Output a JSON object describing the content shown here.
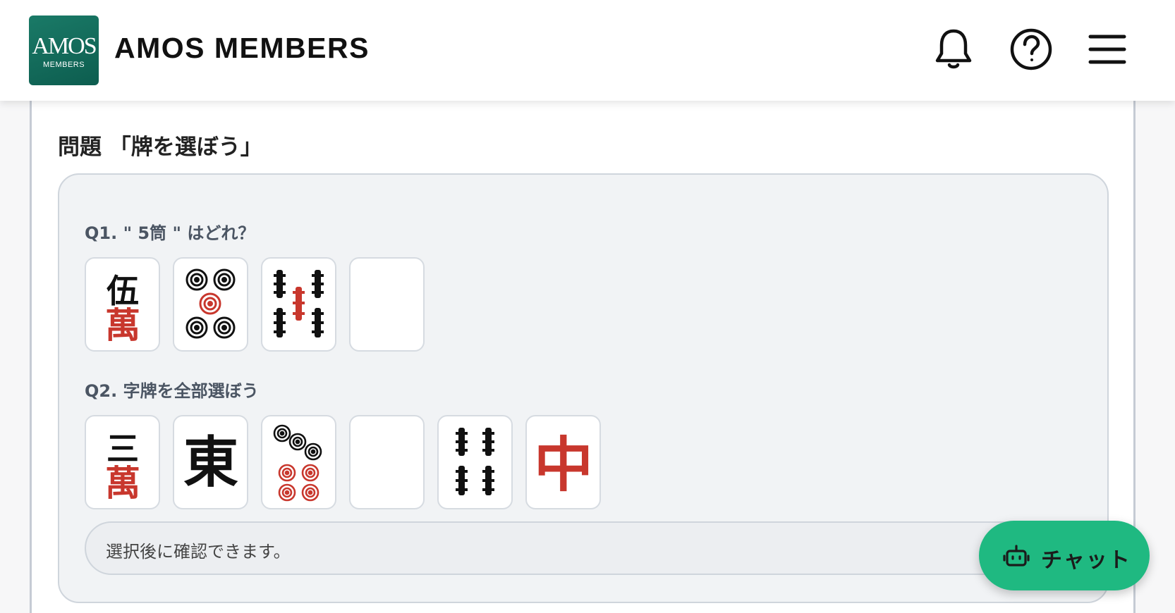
{
  "header": {
    "logo": {
      "main": "AMOS",
      "sub": "MEMBERS"
    },
    "title": "AMOS MEMBERS",
    "icons": [
      "bell-icon",
      "help-circle-icon",
      "hamburger-menu-icon"
    ]
  },
  "page": {
    "section_title": "問題 「牌を選ぼう」"
  },
  "quiz": {
    "q1": {
      "label": "Q1. \" 5筒 \" はどれ？",
      "tiles": [
        {
          "name": "5-man-tile",
          "icon": "character-5-tile",
          "glyph_top": "伍",
          "glyph_bottom": "萬"
        },
        {
          "name": "5-pin-tile",
          "icon": "circle-5-tile"
        },
        {
          "name": "5-sou-tile",
          "icon": "bamboo-5-tile"
        },
        {
          "name": "white-dragon-tile",
          "icon": "blank-tile"
        }
      ]
    },
    "q2": {
      "label": "Q2. 字牌を全部選ぼう",
      "tiles": [
        {
          "name": "3-man-tile",
          "icon": "character-3-tile",
          "glyph_top": "三",
          "glyph_bottom": "萬"
        },
        {
          "name": "east-wind-tile",
          "icon": "east-wind-tile",
          "glyph": "東"
        },
        {
          "name": "7-pin-tile",
          "icon": "circle-7-tile"
        },
        {
          "name": "white-dragon-tile",
          "icon": "blank-tile"
        },
        {
          "name": "4-sou-tile",
          "icon": "bamboo-4-tile"
        },
        {
          "name": "red-dragon-tile",
          "icon": "red-dragon-tile",
          "glyph": "中"
        }
      ]
    },
    "status": "選択後に確認できます。"
  },
  "chat": {
    "label": "チャット",
    "icon": "robot-chat-icon"
  },
  "colors": {
    "brand_green": "#1fb981",
    "logo_green": "#136b5a",
    "tile_red": "#c8372d",
    "tile_black": "#111111"
  }
}
